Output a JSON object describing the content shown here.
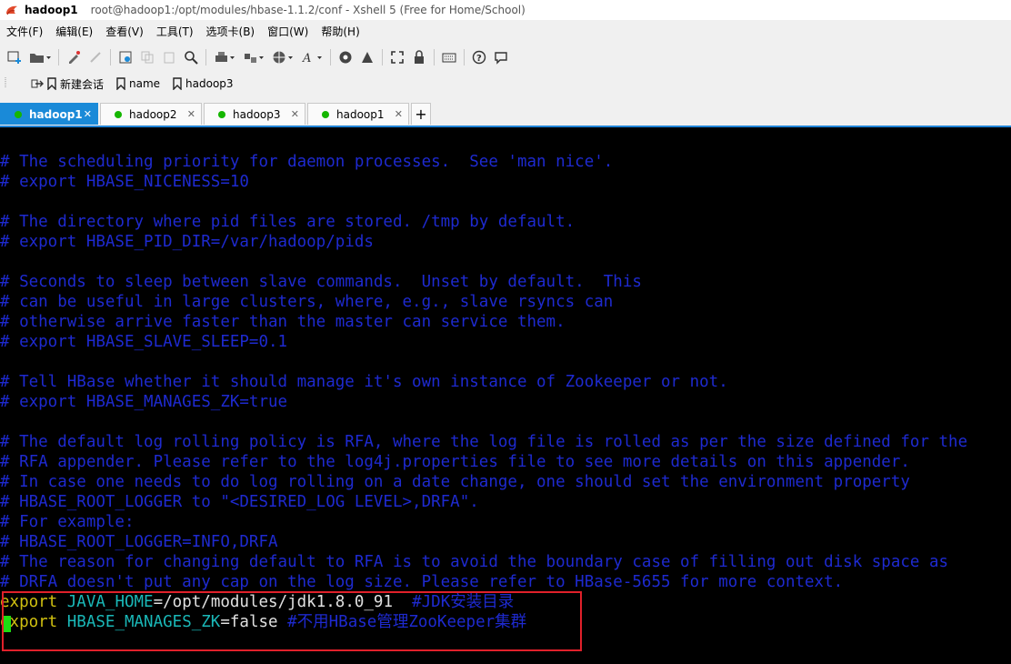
{
  "window": {
    "host": "hadoop1",
    "title": "root@hadoop1:/opt/modules/hbase-1.1.2/conf - Xshell 5 (Free for Home/School)"
  },
  "menu": [
    "文件(F)",
    "编辑(E)",
    "查看(V)",
    "工具(T)",
    "选项卡(B)",
    "窗口(W)",
    "帮助(H)"
  ],
  "bookmarks": [
    "新建会话",
    "name",
    "hadoop3"
  ],
  "tabs": [
    {
      "label": "hadoop1",
      "active": true
    },
    {
      "label": "hadoop2",
      "active": false
    },
    {
      "label": "hadoop3",
      "active": false
    },
    {
      "label": "hadoop1",
      "active": false
    }
  ],
  "add_tab_label": "+",
  "terminal": {
    "comment_lines": [
      "# The scheduling priority for daemon processes.  See 'man nice'.",
      "# export HBASE_NICENESS=10",
      "",
      "# The directory where pid files are stored. /tmp by default.",
      "# export HBASE_PID_DIR=/var/hadoop/pids",
      "",
      "# Seconds to sleep between slave commands.  Unset by default.  This",
      "# can be useful in large clusters, where, e.g., slave rsyncs can",
      "# otherwise arrive faster than the master can service them.",
      "# export HBASE_SLAVE_SLEEP=0.1",
      "",
      "# Tell HBase whether it should manage it's own instance of Zookeeper or not.",
      "# export HBASE_MANAGES_ZK=true",
      "",
      "# The default log rolling policy is RFA, where the log file is rolled as per the size defined for the",
      "# RFA appender. Please refer to the log4j.properties file to see more details on this appender.",
      "# In case one needs to do log rolling on a date change, one should set the environment property",
      "# HBASE_ROOT_LOGGER to \"<DESIRED_LOG LEVEL>,DRFA\".",
      "# For example:",
      "# HBASE_ROOT_LOGGER=INFO,DRFA",
      "# The reason for changing default to RFA is to avoid the boundary case of filling out disk space as",
      "# DRFA doesn't put any cap on the log size. Please refer to HBase-5655 for more context."
    ],
    "export1": {
      "keyword": "export",
      "name": "JAVA_HOME",
      "eq": "=",
      "value": "/opt/modules/jdk1.8.0_91",
      "comment": "  #JDK安装目录"
    },
    "export2": {
      "keyword": "export",
      "name": "HBASE_MANAGES_ZK",
      "eq": "=",
      "value": "false",
      "comment": " #不用HBase管理ZooKeeper集群"
    }
  }
}
